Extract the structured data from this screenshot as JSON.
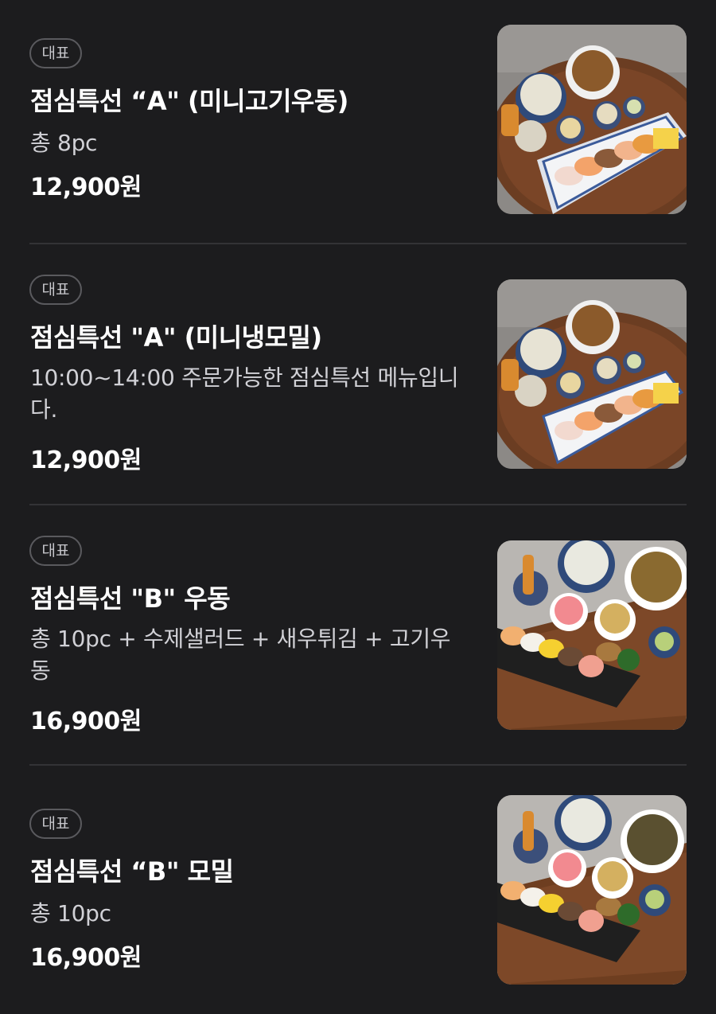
{
  "menu": {
    "items": [
      {
        "badge": "대표",
        "title": "점심특선 “A\" (미니고기우동)",
        "desc": "총 8pc",
        "price": "12,900원",
        "photo": "sushi-set-a-udon-photo"
      },
      {
        "badge": "대표",
        "title": "점심특선 \"A\" (미니냉모밀)",
        "desc": "10:00~14:00 주문가능한 점심특선 메뉴입니다.",
        "price": "12,900원",
        "photo": "sushi-set-a-soba-photo"
      },
      {
        "badge": "대표",
        "title": "점심특선 \"B\" 우동",
        "desc": "총 10pc + 수제샐러드 + 새우튀김 + 고기우동",
        "price": "16,900원",
        "photo": "sushi-set-b-udon-photo"
      },
      {
        "badge": "대표",
        "title": "점심특선 “B\" 모밀",
        "desc": "총 10pc",
        "price": "16,900원",
        "photo": "sushi-set-b-soba-photo"
      }
    ]
  },
  "colors": {
    "background": "#1c1c1e",
    "text": "#ffffff",
    "secondary_text": "#d1d1d6",
    "badge_border": "#5a5a5e",
    "divider": "#333336"
  }
}
